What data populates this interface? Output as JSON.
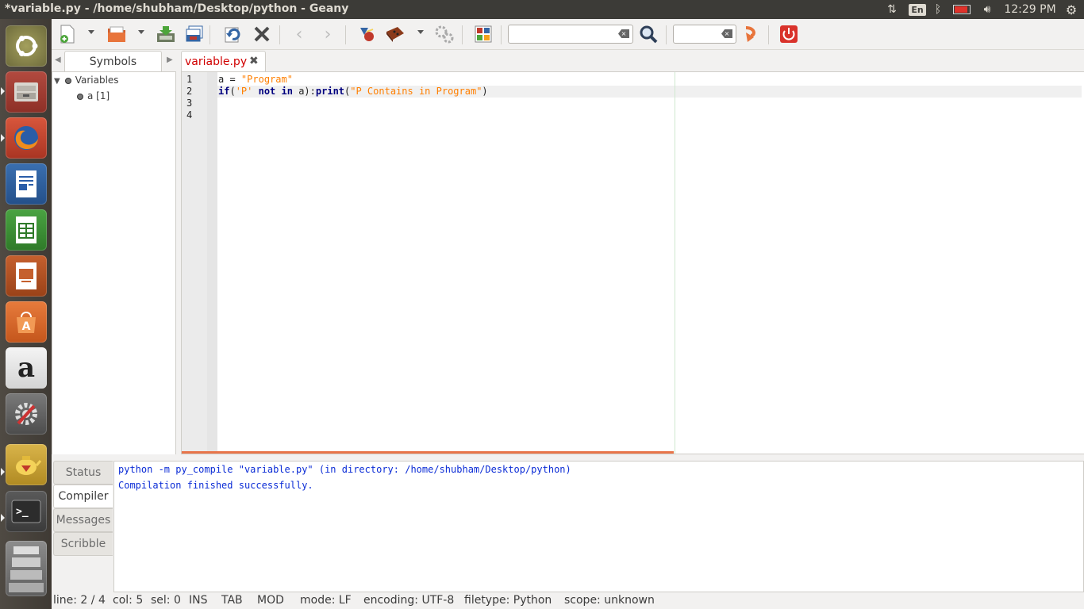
{
  "window": {
    "title": "*variable.py - /home/shubham/Desktop/python - Geany"
  },
  "top_panel": {
    "keyboard_layout": "En",
    "clock": "12:29 PM"
  },
  "launcher": {
    "items": [
      {
        "name": "ubuntu-dash",
        "label": "Dash"
      },
      {
        "name": "files",
        "label": "Files"
      },
      {
        "name": "firefox",
        "label": "Firefox"
      },
      {
        "name": "writer",
        "label": "Writer"
      },
      {
        "name": "calc",
        "label": "Calc"
      },
      {
        "name": "impress",
        "label": "Impress"
      },
      {
        "name": "software-center",
        "label": "Software"
      },
      {
        "name": "amazon",
        "label": "a"
      },
      {
        "name": "system-settings",
        "label": "Settings"
      },
      {
        "name": "geany",
        "label": "Geany"
      },
      {
        "name": "terminal",
        "label": ">_"
      },
      {
        "name": "workspaces",
        "label": "Workspaces"
      }
    ]
  },
  "toolbar": {
    "search_value": "",
    "goto_value": "",
    "icons": [
      "new-file-icon",
      "open-file-icon",
      "save-icon",
      "save-all-icon",
      "reload-icon",
      "close-icon",
      "back-icon",
      "forward-icon",
      "compile-icon",
      "build-icon",
      "execute-icon",
      "color-chooser-icon",
      "search-icon",
      "jump-to-line-icon",
      "quit-icon"
    ]
  },
  "sidebar": {
    "tab_label": "Symbols",
    "tree": {
      "group": "Variables",
      "items": [
        "a [1]"
      ]
    }
  },
  "editor": {
    "tab_label": "variable.py",
    "line_numbers": [
      "1",
      "2",
      "3",
      "4"
    ],
    "code": {
      "l1_var": "a",
      "l1_eq": " = ",
      "l1_str": "\"Program\"",
      "l2_if": "if",
      "l2_open": "(",
      "l2_str1": "'P'",
      "l2_sp": " ",
      "l2_not": "not",
      "l2_sp2": " ",
      "l2_in": "in",
      "l2_rest": " a):",
      "l2_print": "print",
      "l2_paren": "(",
      "l2_str2": "\"P Contains in Program\"",
      "l2_close": ")"
    }
  },
  "message_window": {
    "tabs": [
      "Status",
      "Compiler",
      "Messages",
      "Scribble"
    ],
    "active_tab": "Compiler",
    "lines": [
      "python -m py_compile \"variable.py\" (in directory: /home/shubham/Desktop/python)",
      "Compilation finished successfully."
    ]
  },
  "statusbar": {
    "line": "line: 2 / 4",
    "col": "col: 5",
    "sel": "sel: 0",
    "ins": "INS",
    "tab": "TAB",
    "mod": "MOD",
    "mode": "mode: LF",
    "encoding": "encoding: UTF-8",
    "filetype": "filetype: Python",
    "scope": "scope: unknown"
  },
  "colors": {
    "accent": "#e8754a",
    "panel": "#3c3b37",
    "string": "#ff7f00",
    "keyword": "#00007f",
    "tab_modified": "#d10000"
  }
}
